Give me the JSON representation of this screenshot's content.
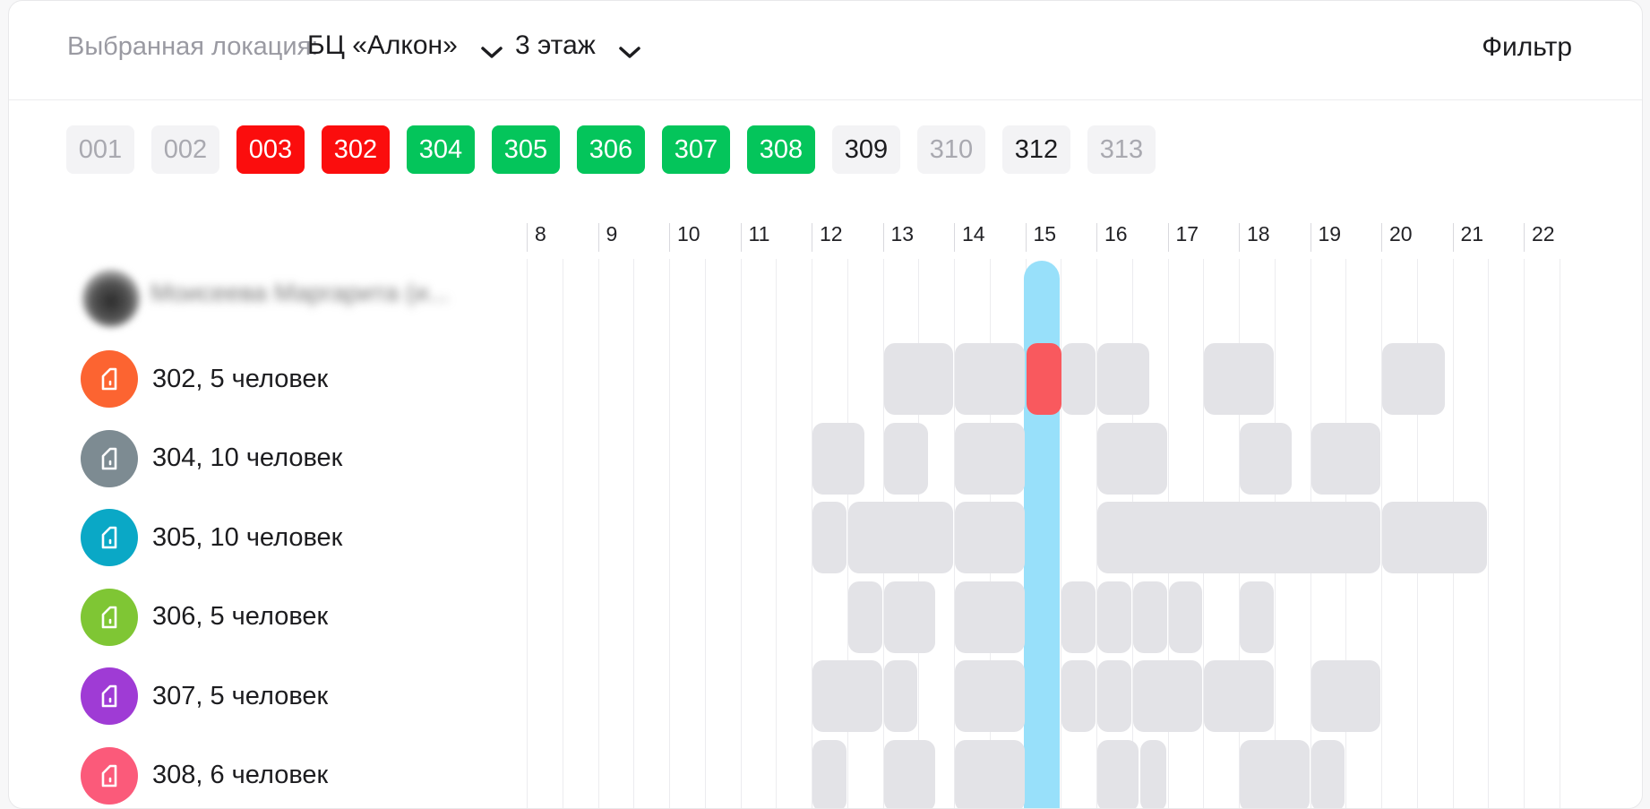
{
  "header": {
    "location_label": "Выбранная локация:",
    "location_value": "БЦ «Алкон»",
    "floor_value": "3 этаж",
    "filter_label": "Фильтр"
  },
  "room_chips": [
    {
      "label": "001",
      "state": "off"
    },
    {
      "label": "002",
      "state": "off"
    },
    {
      "label": "003",
      "state": "busy"
    },
    {
      "label": "302",
      "state": "busy"
    },
    {
      "label": "304",
      "state": "free"
    },
    {
      "label": "305",
      "state": "free"
    },
    {
      "label": "306",
      "state": "free"
    },
    {
      "label": "307",
      "state": "free"
    },
    {
      "label": "308",
      "state": "free"
    },
    {
      "label": "309",
      "state": "grey"
    },
    {
      "label": "310",
      "state": "off"
    },
    {
      "label": "312",
      "state": "grey"
    },
    {
      "label": "313",
      "state": "off"
    }
  ],
  "timeline": {
    "hours": [
      "8",
      "9",
      "10",
      "11",
      "12",
      "13",
      "14",
      "15",
      "16",
      "17",
      "18",
      "19",
      "20",
      "21",
      "22"
    ],
    "current_hour": 15
  },
  "user_row": {
    "name": "Моисеева Маргарита (и..."
  },
  "rooms": [
    {
      "label": "302, 5 человек",
      "color": "#fc6431",
      "bookings": [
        [
          13,
          14
        ],
        [
          14,
          15
        ],
        [
          15,
          15.5
        ],
        [
          15.5,
          16
        ],
        [
          16,
          16.75
        ],
        [
          17.5,
          18.5
        ],
        [
          20,
          20.9
        ]
      ],
      "current": [
        15,
        15.5
      ]
    },
    {
      "label": "304, 10 человек",
      "color": "#7d8b92",
      "bookings": [
        [
          12,
          12.75
        ],
        [
          13,
          13.65
        ],
        [
          14,
          15
        ],
        [
          16,
          17
        ],
        [
          18,
          18.75
        ],
        [
          19,
          20
        ]
      ]
    },
    {
      "label": "305, 10 человек",
      "color": "#0aa8c6",
      "bookings": [
        [
          12,
          12.5
        ],
        [
          12.5,
          14
        ],
        [
          14,
          15
        ],
        [
          16,
          20
        ],
        [
          20,
          21.5
        ]
      ]
    },
    {
      "label": "306, 5 человек",
      "color": "#7fc634",
      "bookings": [
        [
          12.5,
          13
        ],
        [
          13,
          13.75
        ],
        [
          14,
          15
        ],
        [
          15.5,
          16
        ],
        [
          16,
          16.5
        ],
        [
          16.5,
          17
        ],
        [
          17,
          17.5
        ],
        [
          18,
          18.5
        ]
      ]
    },
    {
      "label": "307, 5 человек",
      "color": "#9f3bd5",
      "bookings": [
        [
          12,
          13
        ],
        [
          13,
          13.5
        ],
        [
          14,
          15
        ],
        [
          15.5,
          16
        ],
        [
          16,
          16.5
        ],
        [
          16.5,
          17.5
        ],
        [
          17.5,
          18.5
        ],
        [
          19,
          20
        ]
      ]
    },
    {
      "label": "308, 6 человек",
      "color": "#fb5a7a",
      "bookings": [
        [
          12,
          12.5
        ],
        [
          13,
          13.75
        ],
        [
          14,
          15
        ],
        [
          16,
          16.6
        ],
        [
          16.6,
          17
        ],
        [
          18,
          19
        ],
        [
          19,
          19.5
        ]
      ]
    }
  ],
  "icons": {
    "chevron": "chevron-down-icon",
    "room": "room-door-icon"
  }
}
